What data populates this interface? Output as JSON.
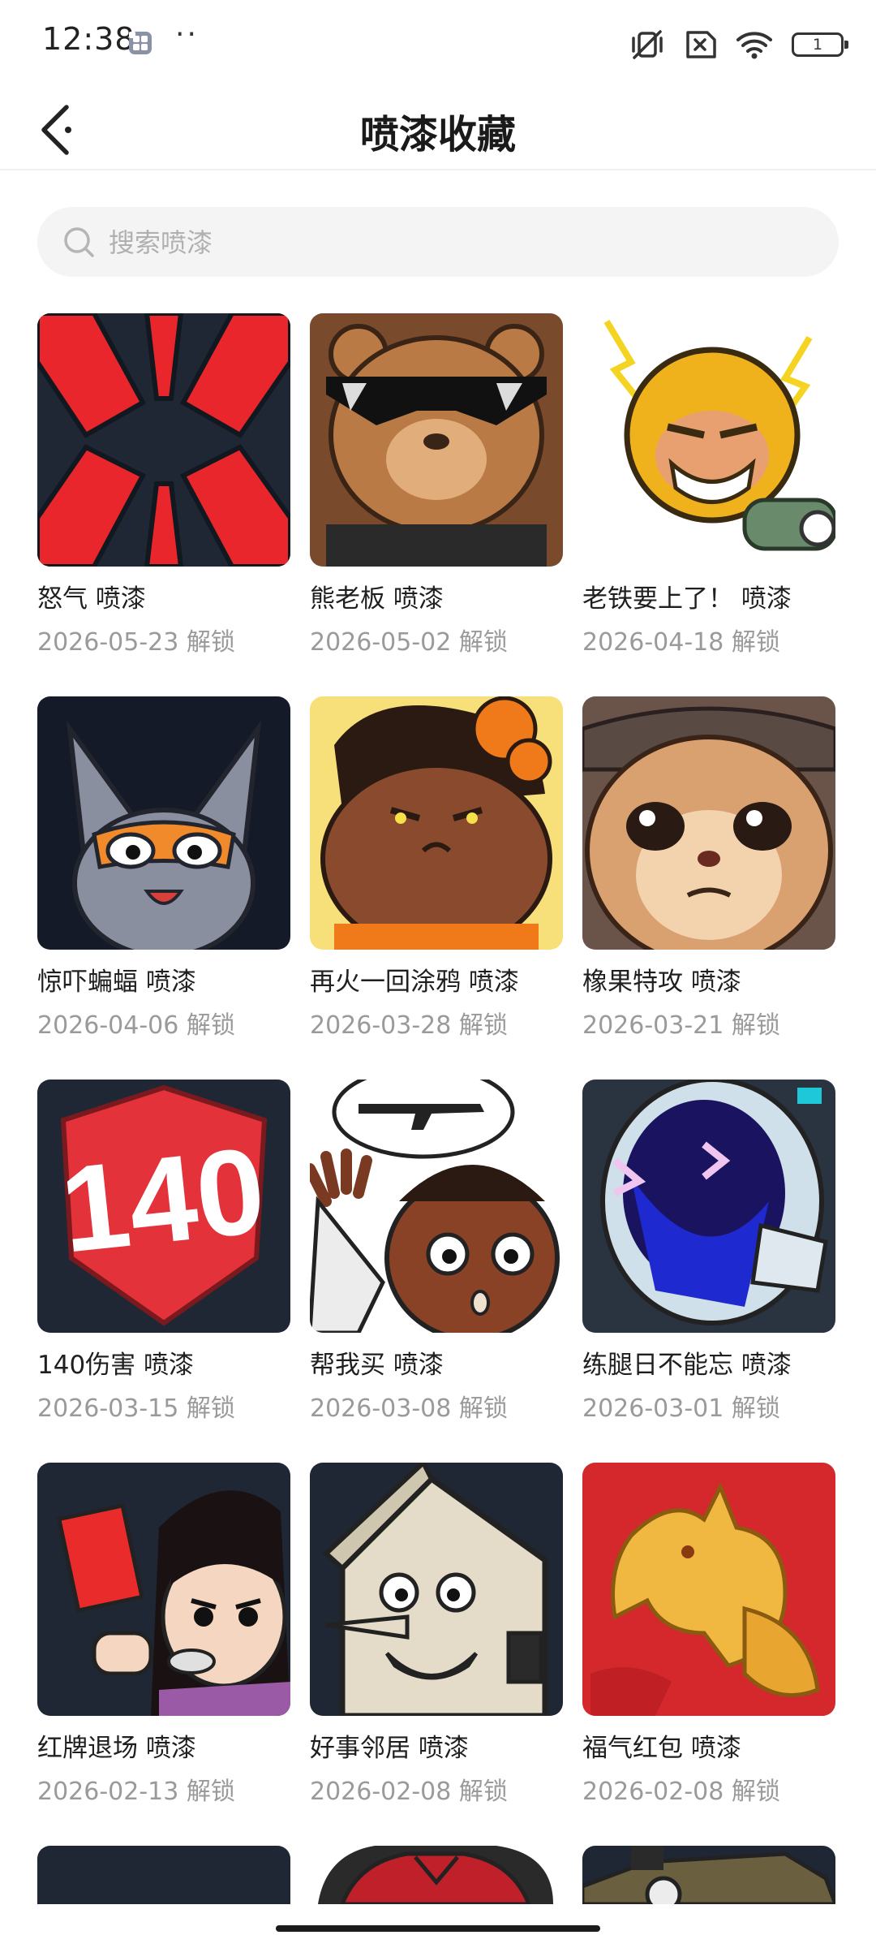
{
  "status_bar": {
    "time": "12:38",
    "dots": "··",
    "battery": "1"
  },
  "header": {
    "title": "喷漆收藏",
    "back_icon": "chevron-left-icon"
  },
  "search": {
    "placeholder": "搜索喷漆",
    "value": ""
  },
  "sprays": [
    {
      "name": "怒气 喷漆",
      "date": "2026-05-23 解锁"
    },
    {
      "name": "熊老板 喷漆",
      "date": "2026-05-02 解锁"
    },
    {
      "name": "老铁要上了！ 喷漆",
      "date": "2026-04-18 解锁"
    },
    {
      "name": "惊吓蝙蝠 喷漆",
      "date": "2026-04-06 解锁"
    },
    {
      "name": "再火一回涂鸦 喷漆",
      "date": "2026-03-28 解锁"
    },
    {
      "name": "橡果特攻 喷漆",
      "date": "2026-03-21 解锁"
    },
    {
      "name": "140伤害 喷漆",
      "date": "2026-03-15 解锁"
    },
    {
      "name": "帮我买 喷漆",
      "date": "2026-03-08 解锁"
    },
    {
      "name": "练腿日不能忘 喷漆",
      "date": "2026-03-01 解锁"
    },
    {
      "name": "红牌退场 喷漆",
      "date": "2026-02-13 解锁"
    },
    {
      "name": "好事邻居 喷漆",
      "date": "2026-02-08 解锁"
    },
    {
      "name": "福气红包 喷漆",
      "date": "2026-02-08 解锁"
    }
  ],
  "badge_140": "140",
  "colors": {
    "accent_red": "#e8262c",
    "dark_bg": "#1f2734",
    "text_secondary": "#9a9a9a"
  }
}
